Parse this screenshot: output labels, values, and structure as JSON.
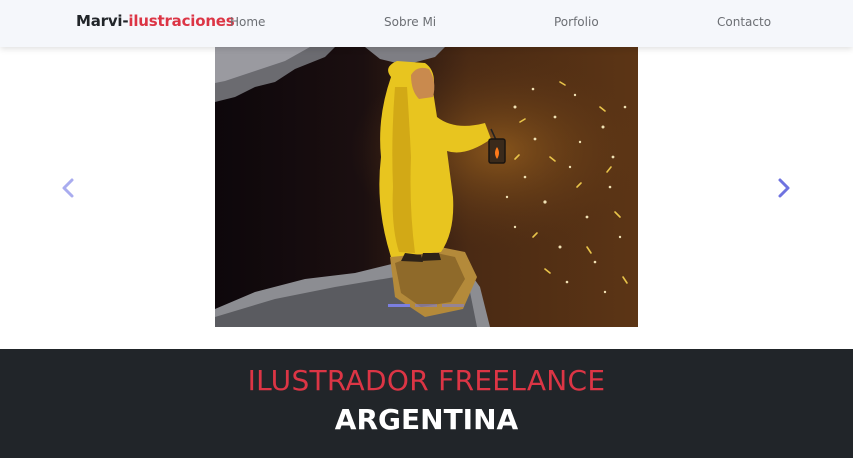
{
  "navbar": {
    "brand_main": "Marvi-",
    "brand_accent": "ilustraciones",
    "links": [
      "Home",
      "Sobre Mi",
      "Porfolio",
      "Contacto"
    ]
  },
  "carousel": {
    "image_icon": "illustration-yellow-raincoat-child-lantern",
    "prev_icon": "chevron-left-icon",
    "next_icon": "chevron-right-icon",
    "slide_count": 3,
    "active_slide": 1
  },
  "hero": {
    "title": "ILUSTRADOR FREELANCE",
    "subtitle": "ARGENTINA"
  },
  "colors": {
    "accent": "#dc3545",
    "dark": "#212529",
    "control": "#7b7fe0"
  }
}
